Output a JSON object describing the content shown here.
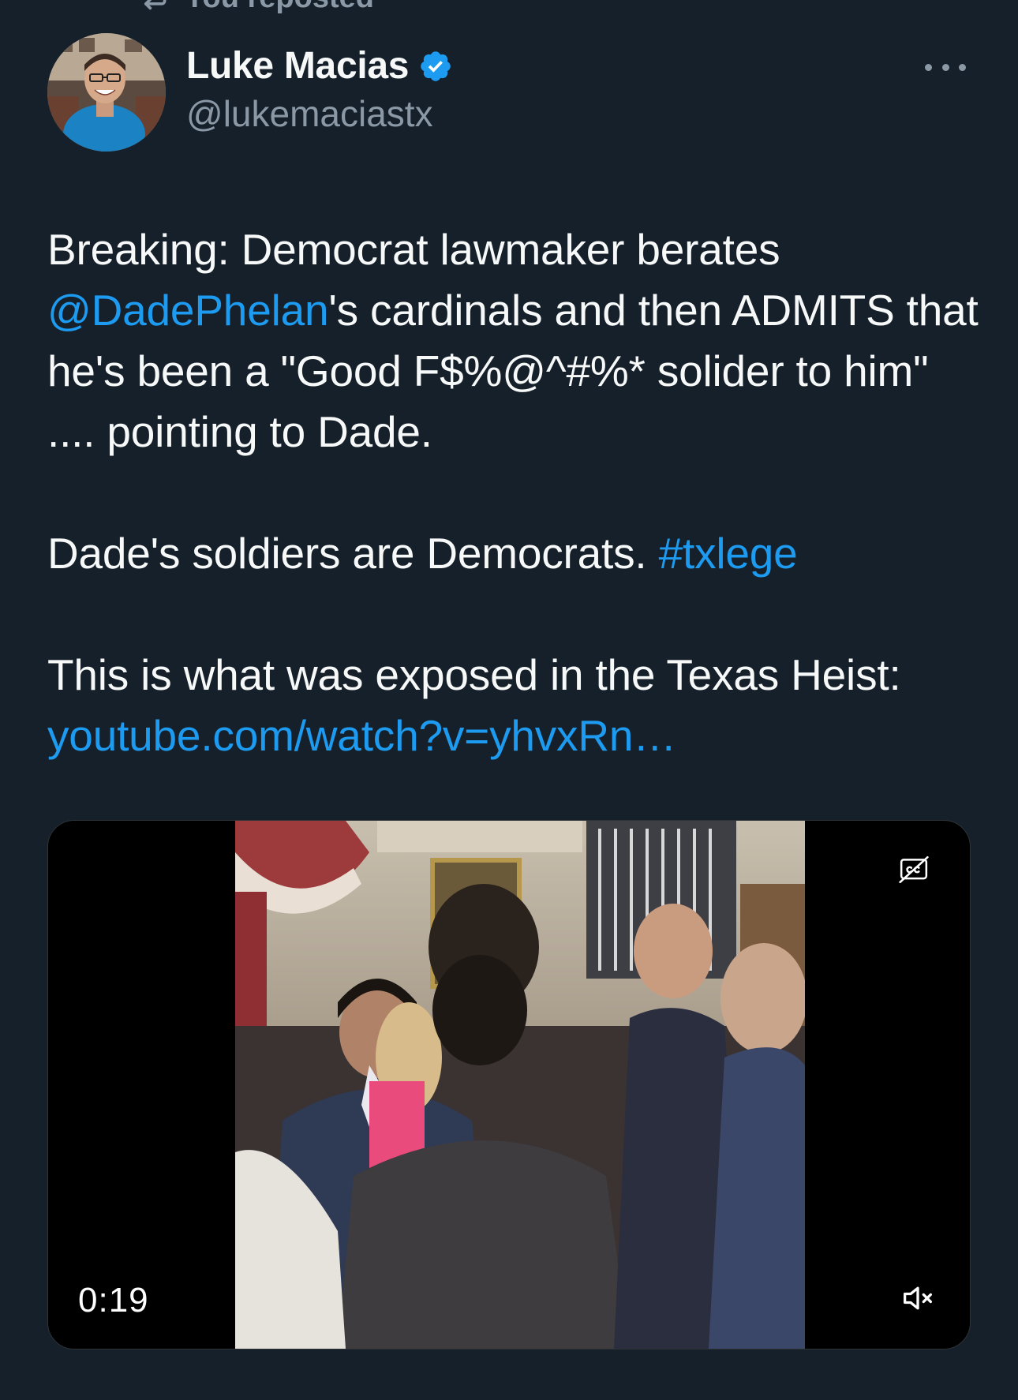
{
  "repost_header": {
    "label": "You reposted",
    "icon": "repost-icon"
  },
  "author": {
    "name": "Luke Macias",
    "handle": "@lukemaciastx",
    "verified": true,
    "verified_color": "#1d9bf0"
  },
  "tweet": {
    "line1_text": "Breaking: Democrat lawmaker berates ",
    "mention": "@DadePhelan",
    "line1_rest": "'s cardinals and then ADMITS that he's been a \"Good F$%@^#%* solider to him\" .... pointing to Dade.",
    "para2_text": "Dade's soldiers are Democrats. ",
    "hashtag": "#txlege",
    "para3_text": "This is what was exposed in the Texas Heist:",
    "url": "youtube.com/watch?v=yhvxRn…"
  },
  "media": {
    "duration": "0:19",
    "captions_icon": "closed-captions-off-icon",
    "mute_icon": "speaker-muted-icon"
  },
  "colors": {
    "background": "#15202b",
    "link": "#1d9bf0",
    "secondary_text": "#8b98a5",
    "primary_text": "#f7f9f9"
  }
}
